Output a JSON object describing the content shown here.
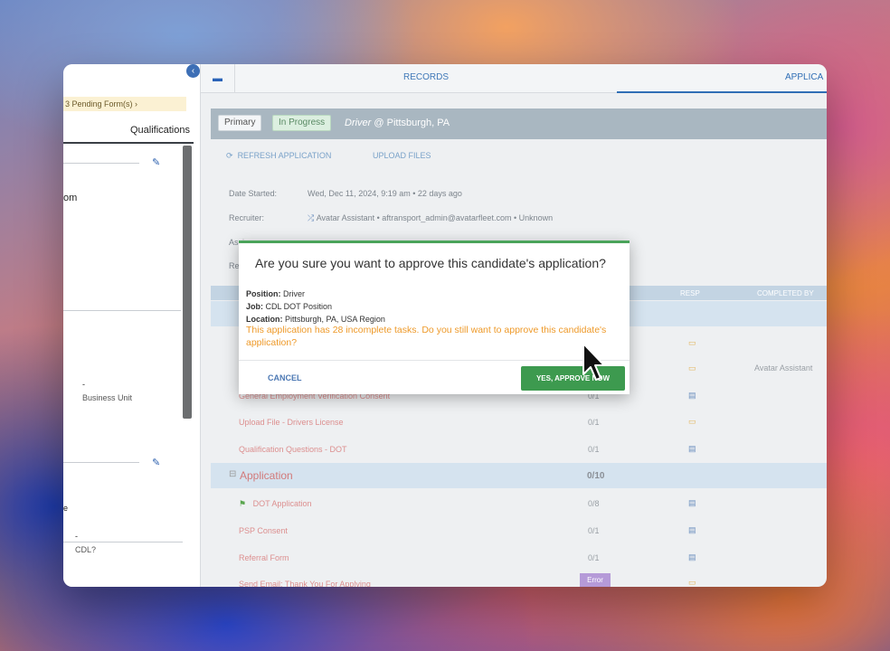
{
  "left_panel": {
    "pending": "3 Pending Form(s) ›",
    "tab": "Qualifications",
    "partial_om": "om",
    "dash_1": "-",
    "business_unit": "Business Unit",
    "partial_e": "e",
    "dash_2": "-",
    "cdl": "CDL?"
  },
  "topbar": {
    "records": "RECORDS",
    "applications": "APPLICA"
  },
  "status": {
    "primary": "Primary",
    "in_progress": "In Progress",
    "job_role": "Driver",
    "job_location": " @ Pittsburgh, PA"
  },
  "actions": {
    "refresh": "REFRESH APPLICATION",
    "upload": "UPLOAD FILES"
  },
  "info": {
    "date_label": "Date Started:",
    "date_value": "Wed, Dec 11, 2024, 9:19 am • 22 days ago",
    "recruiter_label": "Recruiter:",
    "recruiter_value": "Avatar Assistant • aftransport_admin@avatarfleet.com • Unknown",
    "assignee_label": "Assignee:",
    "re_label": "Re"
  },
  "table": {
    "resp_header": "RESP",
    "completed_header": "COMPLETED BY",
    "completed_by_value": "Avatar Assistant",
    "groups": [
      {
        "title": "Application",
        "count": "0/10"
      }
    ],
    "tasks": [
      {
        "name": "General Employment Verification Consent",
        "count": "0/1"
      },
      {
        "name": "Upload File - Drivers License",
        "count": "0/1"
      },
      {
        "name": "Qualification Questions - DOT",
        "count": "0/1"
      },
      {
        "name": "DOT Application",
        "count": "0/8"
      },
      {
        "name": "PSP Consent",
        "count": "0/1"
      },
      {
        "name": "Referral Form",
        "count": "0/1"
      },
      {
        "name": "Send Email: Thank You For Applying",
        "count": ""
      }
    ],
    "error_badge": "Error"
  },
  "modal": {
    "title": "Are you sure you want to approve this candidate's application?",
    "position_label": "Position:",
    "position_value": " Driver",
    "job_label": "Job:",
    "job_value": " CDL DOT Position",
    "location_label": "Location:",
    "location_value": " Pittsburgh, PA, USA Region",
    "warning": "This application has 28 incomplete tasks. Do you still want to approve this candidate's application?",
    "cancel": "CANCEL",
    "approve": "YES, APPROVE NOW"
  },
  "colors": {
    "accent_blue": "#2f6eb5",
    "approve_green": "#3d9a4f",
    "warning_orange": "#ee9a2a",
    "task_red": "#dc8f8f"
  }
}
